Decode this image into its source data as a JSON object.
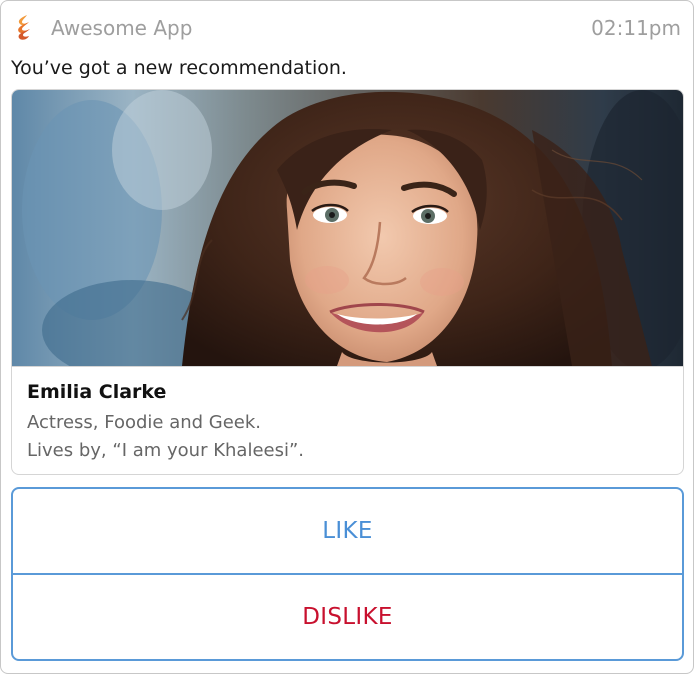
{
  "app": {
    "name": "Awesome App",
    "time": "02:11pm"
  },
  "message": "You’ve got a new recommendation.",
  "recommendation": {
    "name": "Emilia Clarke",
    "bio_line1": "Actress, Foodie and Geek.",
    "bio_line2": "Lives by, “I am your Khaleesi”."
  },
  "actions": {
    "like_label": "LIKE",
    "dislike_label": "DISLIKE"
  },
  "colors": {
    "accent": "#5a9ad8",
    "like": "#4a8fd6",
    "dislike": "#c8102e",
    "logo": "#e8742a"
  },
  "icons": {
    "app_logo": "flame-logo-icon"
  }
}
